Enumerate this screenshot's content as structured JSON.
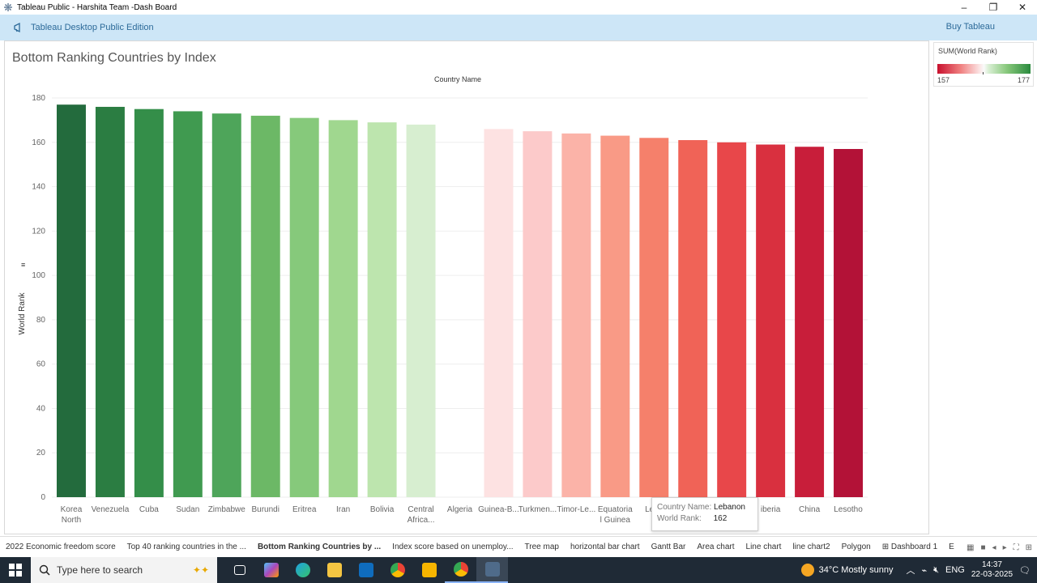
{
  "window": {
    "title": "Tableau Public - Harshita Team -Dash Board",
    "minimize": "–",
    "restore": "❐",
    "close": "✕"
  },
  "edition_bar": {
    "label": "Tableau Desktop Public Edition",
    "buy_label": "Buy Tableau",
    "icon": "megaphone-icon"
  },
  "sheet": {
    "title": "Bottom Ranking  Countries by Index"
  },
  "legend": {
    "title": "SUM(World Rank)",
    "min_label": "157",
    "max_label": "177",
    "color_low": "#c8102e",
    "color_high": "#2a8a3e"
  },
  "tooltip": {
    "country_label": "Country Name:",
    "country_value": "Lebanon",
    "rank_label": "World Rank:",
    "rank_value": "162"
  },
  "chart_data": {
    "type": "bar",
    "title": "Country Name",
    "ylabel": "World Rank",
    "ylim": [
      0,
      180
    ],
    "yticks": [
      0,
      20,
      40,
      60,
      80,
      100,
      120,
      140,
      160,
      180
    ],
    "grid": true,
    "categories": [
      [
        "Korea",
        "North"
      ],
      [
        "Venezuela"
      ],
      [
        "Cuba"
      ],
      [
        "Sudan"
      ],
      [
        "Zimbabwe"
      ],
      [
        "Burundi"
      ],
      [
        "Eritrea"
      ],
      [
        "Iran"
      ],
      [
        "Bolivia"
      ],
      [
        "Central",
        "Africa..."
      ],
      [
        "Algeria"
      ],
      [
        "Guinea-B..."
      ],
      [
        "Turkmen..."
      ],
      [
        "Timor-Le..."
      ],
      [
        "Equatoria",
        "l Guinea"
      ],
      [
        "Leba"
      ],
      [
        "Mali"
      ],
      [
        "Niger"
      ],
      [
        "iberia"
      ],
      [
        "China"
      ],
      [
        "Lesotho"
      ]
    ],
    "values": [
      177,
      176,
      175,
      174,
      173,
      172,
      171,
      170,
      169,
      168,
      null,
      166,
      165,
      164,
      163,
      162,
      161,
      160,
      159,
      158,
      157
    ],
    "colors": [
      "#236b3d",
      "#2b7d42",
      "#348e49",
      "#409a50",
      "#4ea55a",
      "#6cb866",
      "#86c97b",
      "#a0d78f",
      "#bde5ae",
      "#d7eed0",
      "#ffffff",
      "#fde2e2",
      "#fccaca",
      "#fbb3a8",
      "#f99a86",
      "#f5806b",
      "#f06357",
      "#e8474a",
      "#d9303f",
      "#c81e3a",
      "#b31237"
    ]
  },
  "tabs": [
    {
      "label": "2022 Economic  freedom score",
      "active": false
    },
    {
      "label": "Top 40 ranking  countries in the ...",
      "active": false
    },
    {
      "label": "Bottom Ranking  Countries by ...",
      "active": true
    },
    {
      "label": "Index score based on unemploy...",
      "active": false
    },
    {
      "label": "Tree map",
      "active": false
    },
    {
      "label": "horizontal bar chart",
      "active": false
    },
    {
      "label": "Gantt Bar",
      "active": false
    },
    {
      "label": "Area chart",
      "active": false
    },
    {
      "label": "Line chart",
      "active": false
    },
    {
      "label": "line chart2",
      "active": false
    },
    {
      "label": "Polygon",
      "active": false
    },
    {
      "label": "⊞ Dashboard 1",
      "active": false
    },
    {
      "label": "E",
      "active": false
    }
  ],
  "taskbar": {
    "search_placeholder": "Type here to search",
    "weather": "34°C  Mostly sunny",
    "lang": "ENG",
    "time": "14:37",
    "date": "22-03-2025"
  }
}
